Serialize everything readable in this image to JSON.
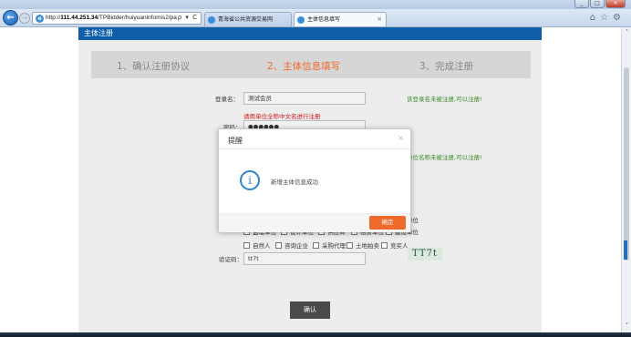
{
  "browser": {
    "url_prefix": "http://",
    "url_host": "111.44.251.34",
    "url_path": "/TPBidder/huiyuaninfomis2/pa",
    "url_tools": "ρ ▾ C",
    "tabs": [
      {
        "label": "青海省公共资源交易网",
        "active": false
      },
      {
        "label": "主体信息填写",
        "active": true
      }
    ],
    "tab_close": "×",
    "toolbar_icons": "⌂☆⚙"
  },
  "page": {
    "header_title": "主体注册",
    "steps": [
      {
        "label": "1、确认注册协议",
        "current": false
      },
      {
        "label": "2、主体信息填写",
        "current": true
      },
      {
        "label": "3、完成注册",
        "current": false
      }
    ]
  },
  "form": {
    "login_label": "登录名：",
    "login_value": "测试会员",
    "login_hint": "该登录名未被注册,可以注册!",
    "unit_name_tip": "请用单位全称中文名进行注册",
    "password_label": "密码：",
    "password_value": "●●●●●●",
    "unit_hint": "单位名称未被注册,可以注册!",
    "partial_right_label": "单位",
    "subject_types_row1": [
      "监理单位",
      "设计单位",
      "供应商",
      "租赁单位",
      "建设单位"
    ],
    "subject_types_row2": [
      "自然人",
      "咨询企业",
      "采购代理",
      "土地拍卖",
      "竞买人"
    ],
    "captcha_label": "验证码：",
    "captcha_value": "tt7t",
    "captcha_image_text": "TT7t",
    "confirm_label": "确认"
  },
  "modal": {
    "title": "提醒",
    "close": "×",
    "icon": "i",
    "message": "新增主体信息成功",
    "ok_label": "确定"
  },
  "scrollbar": {
    "up": "˄",
    "down": "˅"
  }
}
